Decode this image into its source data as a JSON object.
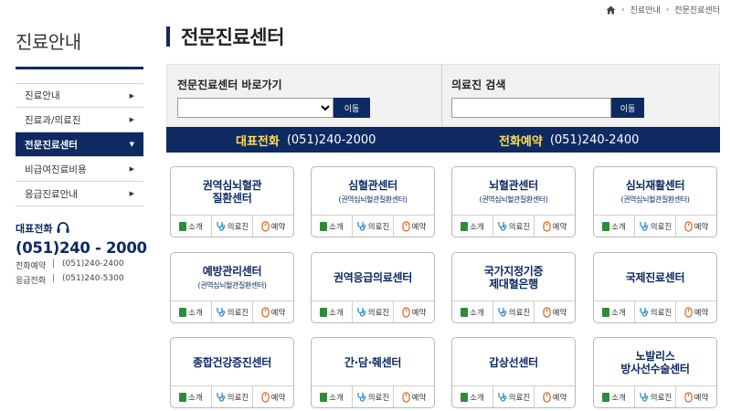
{
  "sidebar": {
    "title": "진료안내",
    "items": [
      {
        "label": "진료안내",
        "active": false
      },
      {
        "label": "진료과/의료진",
        "active": false
      },
      {
        "label": "전문진료센터",
        "active": true
      },
      {
        "label": "비급여진료비용",
        "active": false
      },
      {
        "label": "응급진료안내",
        "active": false
      }
    ],
    "contact": {
      "label": "대표전화",
      "main_number": "(051)240 - 2000",
      "rows": [
        {
          "key": "전화예약",
          "value": "(051)240-2400"
        },
        {
          "key": "응급전화",
          "value": "(051)240-5300"
        }
      ]
    }
  },
  "breadcrumb": [
    "진료안내",
    "전문진료센터"
  ],
  "page_title": "전문진료센터",
  "search": {
    "center_label": "전문진료센터 바로가기",
    "center_go": "이동",
    "doctor_label": "의료진 검색",
    "doctor_placeholder": "",
    "doctor_go": "이동"
  },
  "phones": {
    "main_label": "대표전화",
    "main_number": "(051)240-2000",
    "reserve_label": "전화예약",
    "reserve_number": "(051)240-2400"
  },
  "card_actions": {
    "intro": "소개",
    "doctors": "의료진",
    "reserve": "예약"
  },
  "centers": [
    {
      "name": "권역심뇌혈관\n질환센터",
      "sub": ""
    },
    {
      "name": "심혈관센터",
      "sub": "(권역심뇌혈관질환센터)"
    },
    {
      "name": "뇌혈관센터",
      "sub": "(권역심뇌혈관질환센터)"
    },
    {
      "name": "심뇌재활센터",
      "sub": "(권역심뇌혈관질환센터)"
    },
    {
      "name": "예방관리센터",
      "sub": "(권역심뇌혈관질환센터)"
    },
    {
      "name": "권역응급의료센터",
      "sub": ""
    },
    {
      "name": "국가지정기증\n제대혈은행",
      "sub": ""
    },
    {
      "name": "국제진료센터",
      "sub": ""
    },
    {
      "name": "종합건강증진센터",
      "sub": ""
    },
    {
      "name": "간·담·췌센터",
      "sub": ""
    },
    {
      "name": "갑상선센터",
      "sub": ""
    },
    {
      "name": "노발리스\n방사선수술센터",
      "sub": ""
    }
  ],
  "colors": {
    "navy": "#0e2a63",
    "highlight": "#ffe04a",
    "book_icon": "#2e8b3a",
    "stethoscope_icon": "#2a8fd0",
    "mouse_icon": "#d9651e"
  }
}
